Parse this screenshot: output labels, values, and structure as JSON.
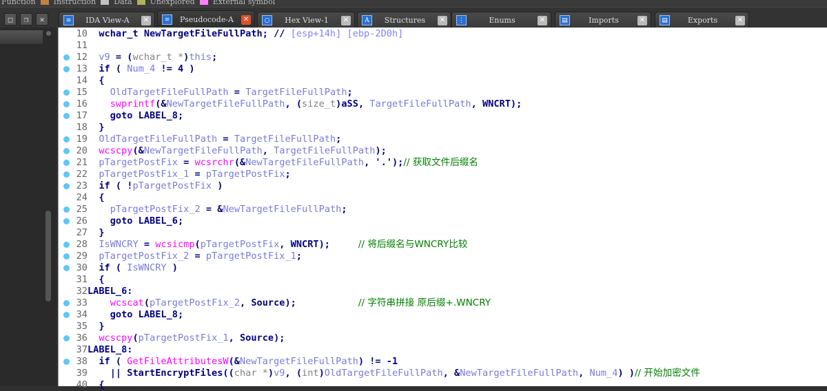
{
  "legend": [
    {
      "label": "Function",
      "color": "#c08040"
    },
    {
      "label": "Instruction",
      "color": "#c0c0c0"
    },
    {
      "label": "Data",
      "color": "#b0b060"
    },
    {
      "label": "Unexplored",
      "color": "#ff80ff"
    },
    {
      "label": "External symbol",
      "color": ""
    }
  ],
  "tabs": [
    {
      "label": "IDA View-A",
      "icon": "disassembly-icon",
      "active": false
    },
    {
      "label": "Pseudocode-A",
      "icon": "pseudocode-icon",
      "active": true
    },
    {
      "label": "Hex View-1",
      "icon": "hex-icon",
      "active": false
    },
    {
      "label": "Structures",
      "icon": "structures-icon",
      "active": false
    },
    {
      "label": "Enums",
      "icon": "enums-icon",
      "active": false
    },
    {
      "label": "Imports",
      "icon": "imports-icon",
      "active": false
    },
    {
      "label": "Exports",
      "icon": "exports-icon",
      "active": false
    }
  ],
  "colors": {
    "keyword": "#000080",
    "variable": "#7a7ad8",
    "function": "#ff00ff",
    "comment": "#008000",
    "breakpoint_dot": "#5ac8fa"
  },
  "code": [
    {
      "n": "10",
      "dot": false,
      "t": [
        [
          "  wchar_t NewTargetFileFullPath; // ",
          "k"
        ],
        [
          "[esp+14h] [ebp-2D0h]",
          "cb"
        ]
      ]
    },
    {
      "n": "11",
      "dot": false,
      "t": []
    },
    {
      "n": "12",
      "dot": true,
      "t": [
        [
          "  ",
          "k"
        ],
        [
          "v9",
          "v"
        ],
        [
          " = (",
          "k"
        ],
        [
          "wchar_t *",
          "g"
        ],
        [
          ")",
          "k"
        ],
        [
          "this",
          "v"
        ],
        [
          ";",
          "k"
        ]
      ]
    },
    {
      "n": "13",
      "dot": true,
      "t": [
        [
          "  if ( ",
          "k"
        ],
        [
          "Num_4",
          "v"
        ],
        [
          " != 4 )",
          "k"
        ]
      ]
    },
    {
      "n": "14",
      "dot": false,
      "t": [
        [
          "  {",
          "k"
        ]
      ]
    },
    {
      "n": "15",
      "dot": true,
      "t": [
        [
          "    ",
          "k"
        ],
        [
          "OldTargetFileFullPath",
          "v"
        ],
        [
          " = ",
          "k"
        ],
        [
          "TargetFileFullPath",
          "v"
        ],
        [
          ";",
          "k"
        ]
      ]
    },
    {
      "n": "16",
      "dot": true,
      "t": [
        [
          "    ",
          "k"
        ],
        [
          "swprintf",
          "f"
        ],
        [
          "(&",
          "k"
        ],
        [
          "NewTargetFileFullPath",
          "v"
        ],
        [
          ", (",
          "k"
        ],
        [
          "size_t",
          "g"
        ],
        [
          ")aSS, ",
          "k"
        ],
        [
          "TargetFileFullPath",
          "v"
        ],
        [
          ", WNCRT);",
          "k"
        ]
      ]
    },
    {
      "n": "17",
      "dot": true,
      "t": [
        [
          "    goto LABEL_8;",
          "k"
        ]
      ]
    },
    {
      "n": "18",
      "dot": false,
      "t": [
        [
          "  }",
          "k"
        ]
      ]
    },
    {
      "n": "19",
      "dot": true,
      "t": [
        [
          "  ",
          "k"
        ],
        [
          "OldTargetFileFullPath",
          "v"
        ],
        [
          " = ",
          "k"
        ],
        [
          "TargetFileFullPath",
          "v"
        ],
        [
          ";",
          "k"
        ]
      ]
    },
    {
      "n": "20",
      "dot": true,
      "t": [
        [
          "  ",
          "k"
        ],
        [
          "wcscpy",
          "f"
        ],
        [
          "(&",
          "k"
        ],
        [
          "NewTargetFileFullPath",
          "v"
        ],
        [
          ", ",
          "k"
        ],
        [
          "TargetFileFullPath",
          "v"
        ],
        [
          ");",
          "k"
        ]
      ]
    },
    {
      "n": "21",
      "dot": true,
      "t": [
        [
          "  ",
          "k"
        ],
        [
          "pTargetPostFix",
          "v"
        ],
        [
          " = ",
          "k"
        ],
        [
          "wcsrchr",
          "f"
        ],
        [
          "(&",
          "k"
        ],
        [
          "NewTargetFileFullPath",
          "v"
        ],
        [
          ", '.');",
          "k"
        ],
        [
          "// 获取文件后缀名",
          "c"
        ]
      ]
    },
    {
      "n": "22",
      "dot": true,
      "t": [
        [
          "  ",
          "k"
        ],
        [
          "pTargetPostFix_1",
          "v"
        ],
        [
          " = ",
          "k"
        ],
        [
          "pTargetPostFix",
          "v"
        ],
        [
          ";",
          "k"
        ]
      ]
    },
    {
      "n": "23",
      "dot": true,
      "t": [
        [
          "  if ( !",
          "k"
        ],
        [
          "pTargetPostFix",
          "v"
        ],
        [
          " )",
          "k"
        ]
      ]
    },
    {
      "n": "24",
      "dot": false,
      "t": [
        [
          "  {",
          "k"
        ]
      ]
    },
    {
      "n": "25",
      "dot": true,
      "t": [
        [
          "    ",
          "k"
        ],
        [
          "pTargetPostFix_2",
          "v"
        ],
        [
          " = &",
          "k"
        ],
        [
          "NewTargetFileFullPath",
          "v"
        ],
        [
          ";",
          "k"
        ]
      ]
    },
    {
      "n": "26",
      "dot": true,
      "t": [
        [
          "    goto LABEL_6;",
          "k"
        ]
      ]
    },
    {
      "n": "27",
      "dot": false,
      "t": [
        [
          "  }",
          "k"
        ]
      ]
    },
    {
      "n": "28",
      "dot": true,
      "t": [
        [
          "  ",
          "k"
        ],
        [
          "IsWNCRY",
          "v"
        ],
        [
          " = ",
          "k"
        ],
        [
          "wcsicmp",
          "f"
        ],
        [
          "(",
          "k"
        ],
        [
          "pTargetPostFix",
          "v"
        ],
        [
          ", WNCRT);     ",
          "k"
        ],
        [
          "// 将后缀名与WNCRY比较",
          "c"
        ]
      ]
    },
    {
      "n": "29",
      "dot": true,
      "t": [
        [
          "  ",
          "k"
        ],
        [
          "pTargetPostFix_2",
          "v"
        ],
        [
          " = ",
          "k"
        ],
        [
          "pTargetPostFix_1",
          "v"
        ],
        [
          ";",
          "k"
        ]
      ]
    },
    {
      "n": "30",
      "dot": true,
      "t": [
        [
          "  if ( ",
          "k"
        ],
        [
          "IsWNCRY",
          "v"
        ],
        [
          " )",
          "k"
        ]
      ]
    },
    {
      "n": "31",
      "dot": false,
      "t": [
        [
          "  {",
          "k"
        ]
      ]
    },
    {
      "n": "32",
      "dot": false,
      "t": [
        [
          "LABEL_6:",
          "k"
        ]
      ]
    },
    {
      "n": "33",
      "dot": true,
      "t": [
        [
          "    ",
          "k"
        ],
        [
          "wcscat",
          "f"
        ],
        [
          "(",
          "k"
        ],
        [
          "pTargetPostFix_2",
          "v"
        ],
        [
          ", Source);           ",
          "k"
        ],
        [
          "// 字符串拼接 原后缀+.WNCRY",
          "c"
        ]
      ]
    },
    {
      "n": "34",
      "dot": true,
      "t": [
        [
          "    goto LABEL_8;",
          "k"
        ]
      ]
    },
    {
      "n": "35",
      "dot": false,
      "t": [
        [
          "  }",
          "k"
        ]
      ]
    },
    {
      "n": "36",
      "dot": true,
      "t": [
        [
          "  ",
          "k"
        ],
        [
          "wcscpy",
          "f"
        ],
        [
          "(",
          "k"
        ],
        [
          "pTargetPostFix_1",
          "v"
        ],
        [
          ", Source);",
          "k"
        ]
      ]
    },
    {
      "n": "37",
      "dot": false,
      "t": [
        [
          "LABEL_8:",
          "k"
        ]
      ]
    },
    {
      "n": "38",
      "dot": true,
      "t": [
        [
          "  if ( ",
          "k"
        ],
        [
          "GetFileAttributesW",
          "f"
        ],
        [
          "(&",
          "k"
        ],
        [
          "NewTargetFileFullPath",
          "v"
        ],
        [
          ") != -1",
          "k"
        ]
      ]
    },
    {
      "n": "39",
      "dot": false,
      "t": [
        [
          "    || StartEncryptFiles((",
          "k"
        ],
        [
          "char *",
          "g"
        ],
        [
          ")",
          "k"
        ],
        [
          "v9",
          "v"
        ],
        [
          ", (",
          "k"
        ],
        [
          "int",
          "g"
        ],
        [
          ")",
          "k"
        ],
        [
          "OldTargetFileFullPath",
          "v"
        ],
        [
          ", &",
          "k"
        ],
        [
          "NewTargetFileFullPath",
          "v"
        ],
        [
          ", ",
          "k"
        ],
        [
          "Num_4",
          "v"
        ],
        [
          ") )",
          "k"
        ],
        [
          "// 开始加密文件",
          "c"
        ]
      ]
    },
    {
      "n": "40",
      "dot": false,
      "t": [
        [
          "  {",
          "k"
        ]
      ]
    }
  ]
}
